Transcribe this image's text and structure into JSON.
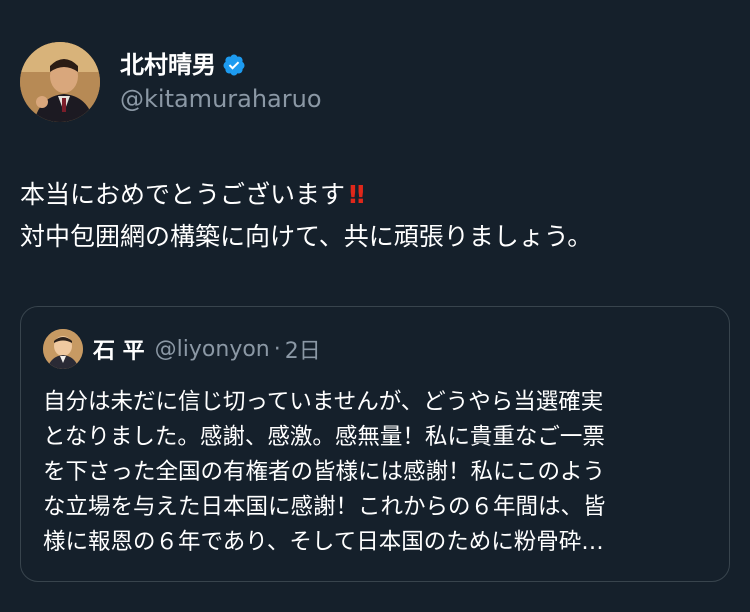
{
  "colors": {
    "background": "#15202b",
    "text_primary": "#ffffff",
    "text_secondary": "#8b98a5",
    "verified": "#1d9bf0",
    "border": "#38444d",
    "emoji_red": "#e0271a"
  },
  "author": {
    "display_name": "北村晴男",
    "handle": "@kitamuraharuo",
    "verified_icon": "verified-badge-icon"
  },
  "tweet": {
    "lines": [
      "本当におめでとうございます",
      "対中包囲網の構築に向けて、共に頑張りましょう。"
    ],
    "emoji": "‼"
  },
  "quoted_tweet": {
    "display_name": "石 平",
    "handle": "@liyonyon",
    "separator": "·",
    "time": "2日",
    "lines": [
      "自分は未だに信じ切っていませんが、どうやら当選確実",
      "となりました。感謝、感激。感無量！私に貴重なご一票",
      "を下さった全国の有権者の皆様には感謝！私にこのよう",
      "な立場を与えた日本国に感謝！これからの６年間は、皆",
      "様に報恩の６年であり、そして日本国のために粉骨砕…"
    ]
  }
}
